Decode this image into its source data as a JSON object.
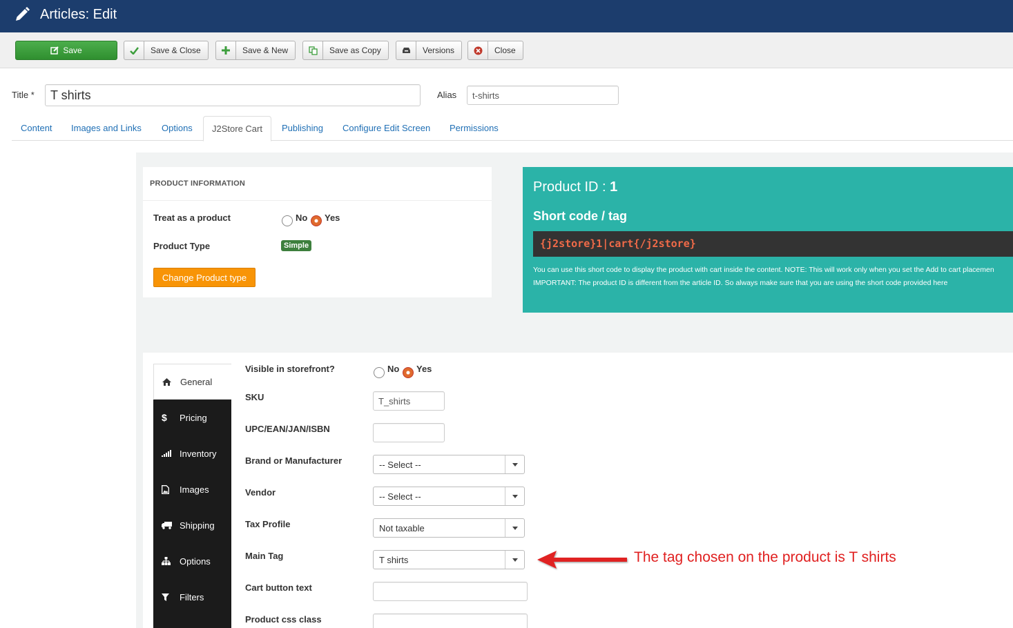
{
  "header": {
    "title": "Articles: Edit"
  },
  "toolbar": {
    "save": "Save",
    "save_close": "Save & Close",
    "save_new": "Save & New",
    "save_copy": "Save as Copy",
    "versions": "Versions",
    "close": "Close"
  },
  "article": {
    "title_label": "Title *",
    "title_value": "T shirts",
    "alias_label": "Alias",
    "alias_value": "t-shirts"
  },
  "tabs": [
    "Content",
    "Images and Links",
    "Options",
    "J2Store Cart",
    "Publishing",
    "Configure Edit Screen",
    "Permissions"
  ],
  "product_info": {
    "heading": "PRODUCT INFORMATION",
    "treat_label": "Treat as a product",
    "no": "No",
    "yes": "Yes",
    "type_label": "Product Type",
    "type_value": "Simple",
    "change_btn": "Change Product type"
  },
  "shortcode": {
    "product_id_label": "Product ID : ",
    "product_id": "1",
    "title": "Short code / tag",
    "code": "{j2store}1|cart{/j2store}",
    "note1": "You can use this short code to display the product with cart inside the content. NOTE: This will work only when you set the Add to cart placemen",
    "note2": "IMPORTANT: The product ID is different from the article ID. So always make sure that you are using the short code provided here"
  },
  "sidenav": [
    "General",
    "Pricing",
    "Inventory",
    "Images",
    "Shipping",
    "Options",
    "Filters"
  ],
  "general": {
    "visible_label": "Visible in storefront?",
    "no": "No",
    "yes": "Yes",
    "sku_label": "SKU",
    "sku_value": "T_shirts",
    "upc_label": "UPC/EAN/JAN/ISBN",
    "upc_value": "",
    "brand_label": "Brand or Manufacturer",
    "brand_value": "-- Select --",
    "vendor_label": "Vendor",
    "vendor_value": "-- Select --",
    "tax_label": "Tax Profile",
    "tax_value": "Not taxable",
    "tag_label": "Main Tag",
    "tag_value": "T shirts",
    "cart_label": "Cart button text",
    "cart_value": "",
    "css_label": "Product css class",
    "css_value": ""
  },
  "annotation": "The tag chosen on the product is T shirts",
  "colors": {
    "header": "#1c3d6d",
    "save_green": "#3c9e3c",
    "teal": "#2bb3a8",
    "orange": "#f89406",
    "annotation_red": "#e02020"
  }
}
